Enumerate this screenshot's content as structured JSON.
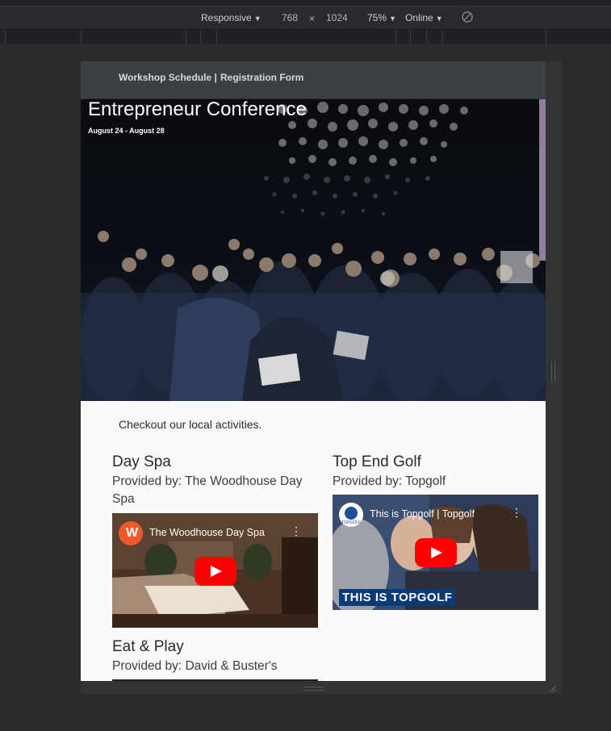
{
  "devtools": {
    "device_mode": "Responsive",
    "width": "768",
    "times": "×",
    "height": "1024",
    "zoom": "75%",
    "network": "Online",
    "arrow": "▼"
  },
  "nav": {
    "links": [
      "Workshop Schedule |",
      "Registration Form"
    ]
  },
  "hero": {
    "title": "Entrepreneur Conference",
    "dates": "August 24 - August 28"
  },
  "intro": "Checkout our local activities.",
  "activities": [
    {
      "title": "Day Spa",
      "provider": "Provided by: The Woodhouse Day Spa",
      "video_title": "The Woodhouse Day Spa",
      "logo_letter": "W"
    },
    {
      "title": "Top End Golf",
      "provider": "Provided by: Topgolf",
      "video_title": "This is Topgolf | Topgolf",
      "banner": "THIS IS TOPGOLF"
    },
    {
      "title": "Eat & Play",
      "provider": "Provided by: David & Buster's"
    }
  ],
  "colors": {
    "nav_bg": "#3c4043",
    "page_bg": "#fafafa",
    "devtools_bg": "#292a2d",
    "youtube_red": "#ff0000",
    "topgolf_blue": "#0b3a79"
  }
}
